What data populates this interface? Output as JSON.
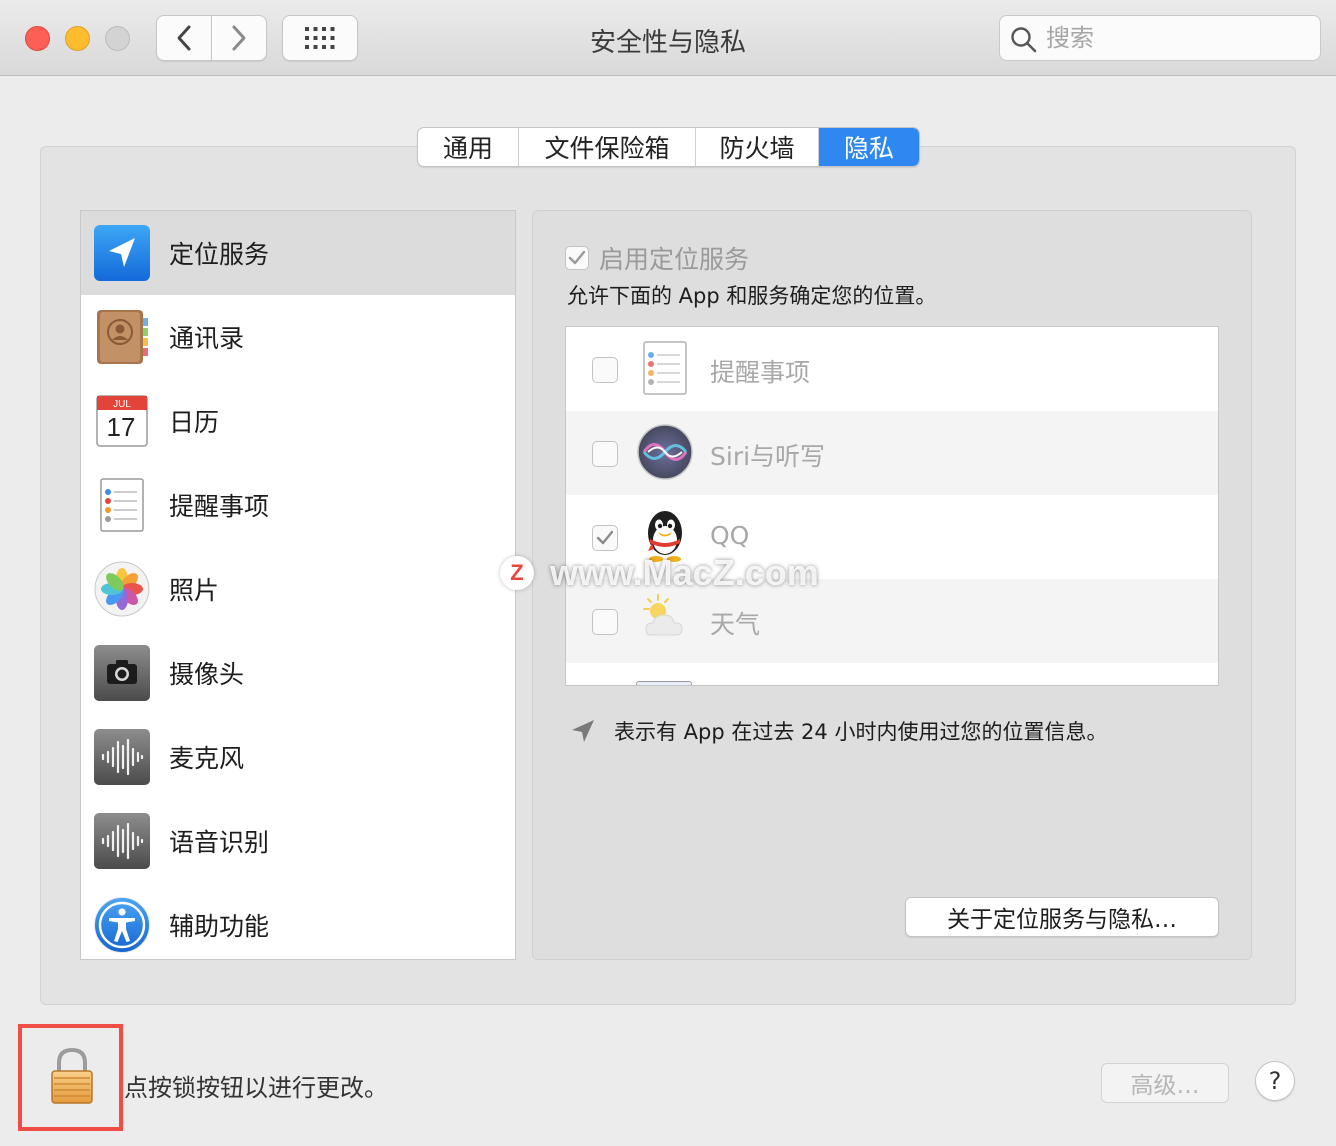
{
  "window": {
    "title": "安全性与隐私"
  },
  "search": {
    "placeholder": "搜索"
  },
  "tabs": [
    {
      "label": "通用",
      "active": false
    },
    {
      "label": "文件保险箱",
      "active": false
    },
    {
      "label": "防火墙",
      "active": false
    },
    {
      "label": "隐私",
      "active": true
    }
  ],
  "categories": [
    {
      "label": "定位服务",
      "icon": "location-arrow-icon",
      "selected": true
    },
    {
      "label": "通讯录",
      "icon": "contacts-icon"
    },
    {
      "label": "日历",
      "icon": "calendar-icon",
      "month": "JUL",
      "day": "17"
    },
    {
      "label": "提醒事项",
      "icon": "reminders-icon"
    },
    {
      "label": "照片",
      "icon": "photos-icon"
    },
    {
      "label": "摄像头",
      "icon": "camera-icon"
    },
    {
      "label": "麦克风",
      "icon": "microphone-icon"
    },
    {
      "label": "语音识别",
      "icon": "speech-recognition-icon"
    },
    {
      "label": "辅助功能",
      "icon": "accessibility-icon"
    }
  ],
  "location": {
    "enable_label": "启用定位服务",
    "enabled": true,
    "description": "允许下面的 App 和服务确定您的位置。",
    "apps": [
      {
        "name": "提醒事项",
        "checked": false,
        "icon": "reminders-icon"
      },
      {
        "name": "Siri与听写",
        "checked": false,
        "icon": "siri-icon"
      },
      {
        "name": "QQ",
        "checked": true,
        "icon": "qq-penguin-icon"
      },
      {
        "name": "天气",
        "checked": false,
        "icon": "weather-icon"
      }
    ],
    "hint": "表示有 App 在过去 24 小时内使用过您的位置信息。",
    "about_button": "关于定位服务与隐私…"
  },
  "bottom": {
    "lock_text": "点按锁按钮以进行更改。",
    "advanced_button": "高级…",
    "help_button": "?"
  },
  "watermark": {
    "logo": "Z",
    "text": "www.MacZ.com"
  },
  "colors": {
    "accent": "#2f87f0",
    "highlight_box": "#ef4d46"
  }
}
